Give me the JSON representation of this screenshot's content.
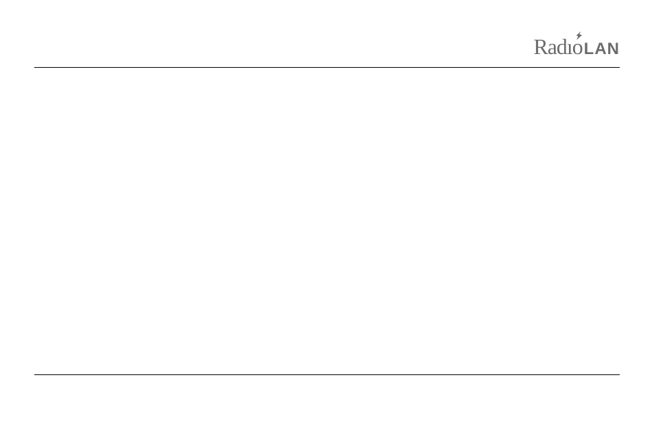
{
  "logo": {
    "prefix": "Radıo",
    "accent": "⚡",
    "suffix": "LAN"
  }
}
